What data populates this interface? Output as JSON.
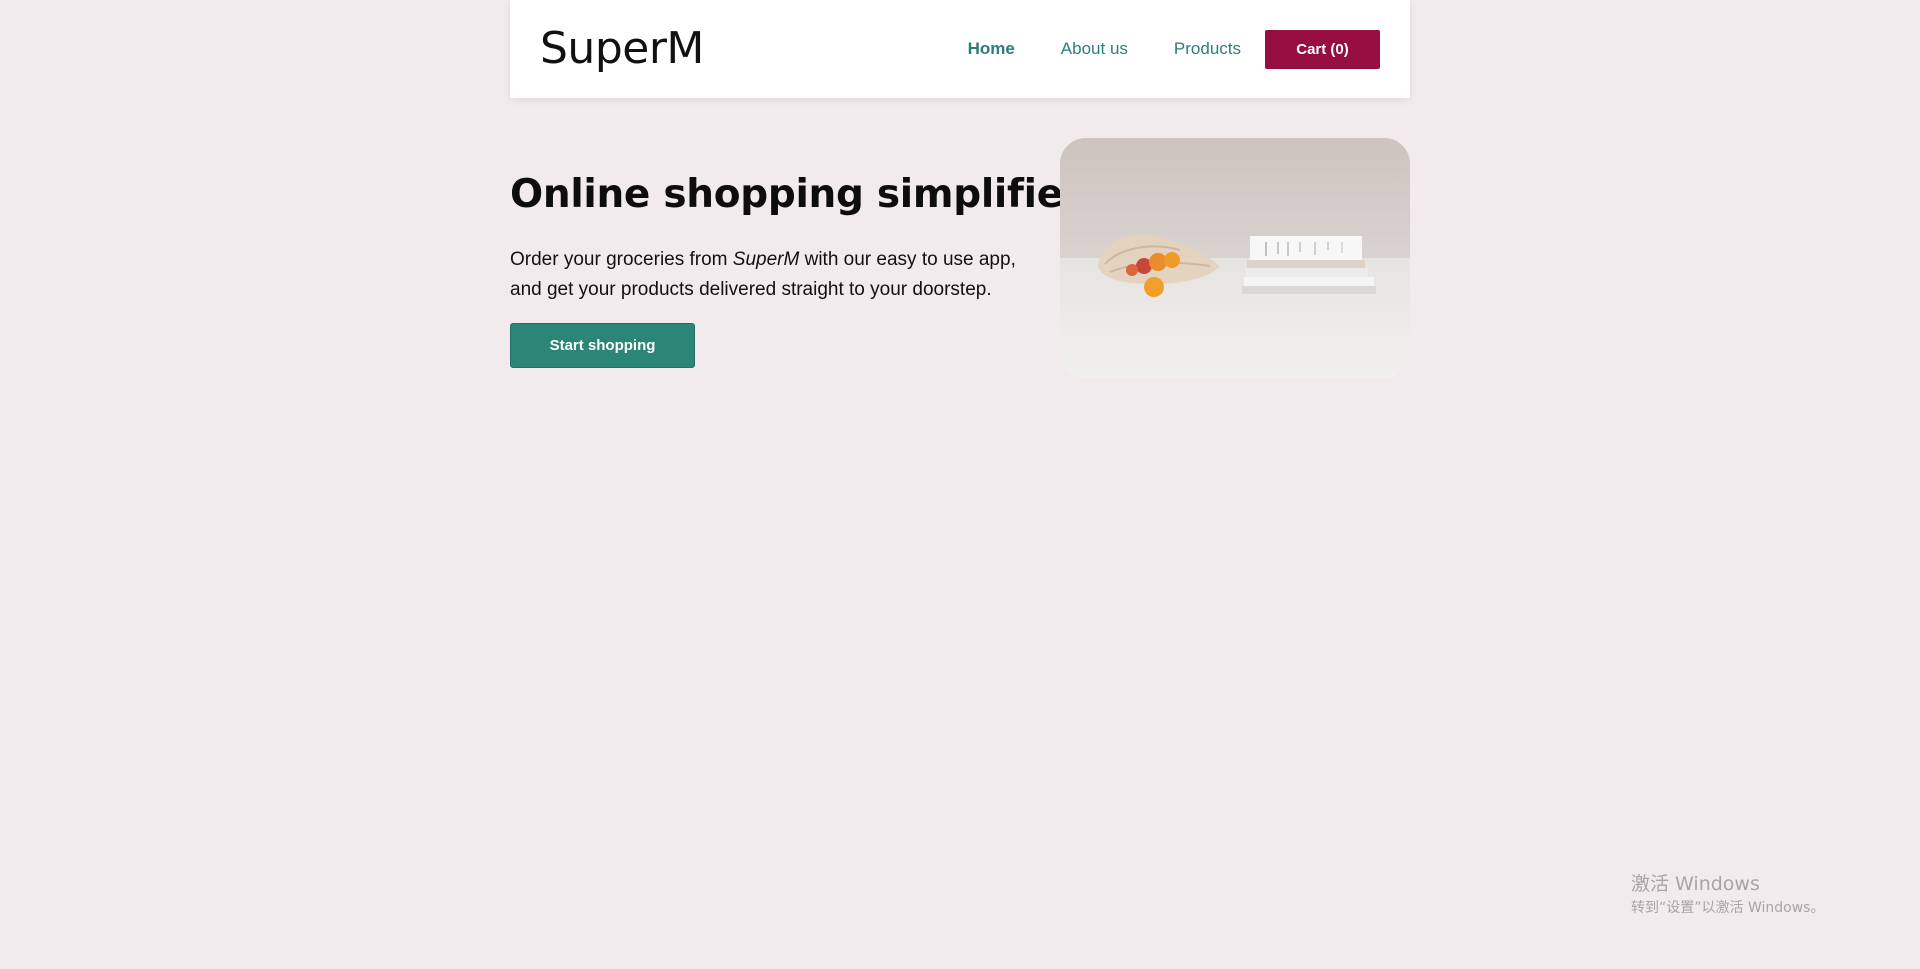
{
  "header": {
    "brand": "SuperM",
    "nav": [
      {
        "label": "Home",
        "active": true
      },
      {
        "label": "About us",
        "active": false
      },
      {
        "label": "Products",
        "active": false
      }
    ],
    "cart_label": "Cart (0)"
  },
  "hero": {
    "title": "Online shopping simplified",
    "text_before": "Order your groceries from ",
    "text_brand": "SuperM",
    "text_after": " with our easy to use app, and get your products delivered straight to your doorstep.",
    "cta_label": "Start shopping",
    "image_icon": "groceries-photo"
  },
  "watermark": {
    "title": "激活 Windows",
    "subtitle": "转到“设置”以激活 Windows。"
  },
  "colors": {
    "background": "#f1ebed",
    "nav_link": "#2d7d78",
    "cart_button": "#960d41",
    "cta_button": "#2b8677"
  }
}
